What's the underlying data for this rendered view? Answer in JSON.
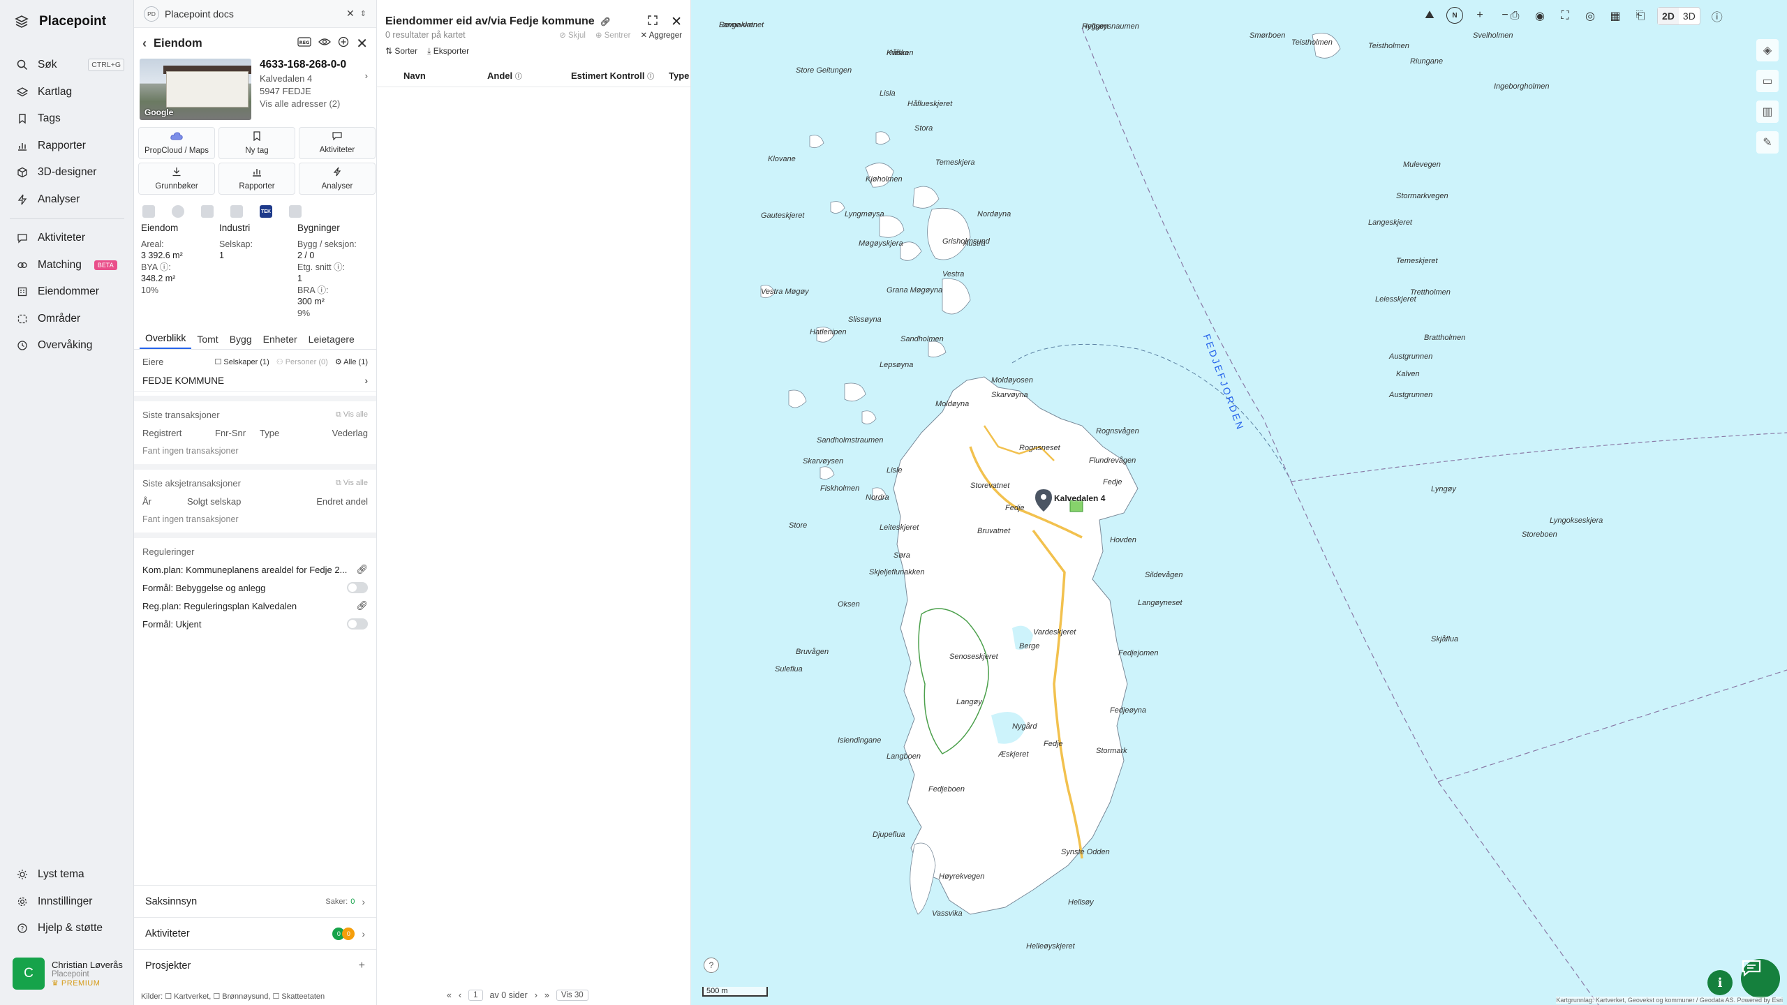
{
  "brand": {
    "name": "Placepoint"
  },
  "nav": {
    "items": [
      {
        "label": "Søk",
        "kbd": "CTRL+G",
        "icon": "search-icon"
      },
      {
        "label": "Kartlag",
        "icon": "layers-icon"
      },
      {
        "label": "Tags",
        "icon": "bookmark-icon"
      },
      {
        "label": "Rapporter",
        "icon": "bar-chart-icon"
      },
      {
        "label": "3D-designer",
        "icon": "cube-icon"
      },
      {
        "label": "Analyser",
        "icon": "bolt-icon"
      }
    ],
    "items2": [
      {
        "label": "Aktiviteter",
        "icon": "chat-icon"
      },
      {
        "label": "Matching",
        "badge": "BETA",
        "icon": "link-icon"
      },
      {
        "label": "Eiendommer",
        "icon": "building-icon"
      },
      {
        "label": "Områder",
        "icon": "area-icon"
      },
      {
        "label": "Overvåking",
        "icon": "clock-icon"
      }
    ],
    "bottom": [
      {
        "label": "Lyst tema",
        "icon": "sun-icon"
      },
      {
        "label": "Innstillinger",
        "icon": "gear-icon"
      },
      {
        "label": "Hjelp & støtte",
        "icon": "help-icon"
      }
    ]
  },
  "user": {
    "initial": "C",
    "name": "Christian Løverås",
    "org": "Placepoint",
    "plan": "PREMIUM"
  },
  "docs": {
    "avatar": "PD",
    "title": "Placepoint docs"
  },
  "property": {
    "header": "Eiendom",
    "gnr": "4633-168-268-0-0",
    "street": "Kalvedalen 4",
    "postal": "5947 FEDJE",
    "all_addresses": "Vis alle adresser (2)",
    "thumb_label": "Google",
    "buttons": [
      "PropCloud / Maps",
      "Ny tag",
      "Aktiviteter",
      "Grunnbøker",
      "Rapporter",
      "Analyser"
    ],
    "src_tek": "TEK",
    "stats": {
      "col1": {
        "head": "Eiendom",
        "l1": "Areal:",
        "v1": "3 392.6 m²",
        "l2": "BYA ⓘ:",
        "v2": "348.2 m²",
        "v3": "10%"
      },
      "col2": {
        "head": "Industri",
        "l1": "Selskap:",
        "v1": "1"
      },
      "col3": {
        "head": "Bygninger",
        "l1": "Bygg / seksjon:",
        "v1": "2 / 0",
        "l2": "Etg. snitt ⓘ:",
        "v2": "1",
        "l3": "BRA ⓘ:",
        "v3": "300 m²",
        "v4": "9%"
      }
    },
    "tabs": [
      "Overblikk",
      "Tomt",
      "Bygg",
      "Enheter",
      "Leietagere"
    ],
    "owners": {
      "label": "Eiere",
      "f1": "Selskaper (1)",
      "f2": "Personer (0)",
      "f3": "Alle (1)",
      "name": "FEDJE KOMMUNE"
    },
    "transactions": {
      "title": "Siste transaksjoner",
      "show_all": "Vis alle",
      "cols": [
        "Registrert",
        "Fnr-Snr",
        "Type",
        "Vederlag"
      ],
      "empty": "Fant ingen transaksjoner"
    },
    "share_tx": {
      "title": "Siste aksjetransaksjoner",
      "show_all": "Vis alle",
      "cols": [
        "År",
        "Solgt selskap",
        "Endret andel"
      ],
      "empty": "Fant ingen transaksjoner"
    },
    "regs": {
      "title": "Reguleringer",
      "r1": "Kom.plan: Kommuneplanens arealdel for Fedje 2...",
      "r2": "Formål: Bebyggelse og anlegg",
      "r3": "Reg.plan: Reguleringsplan Kalvedalen",
      "r4": "Formål: Ukjent"
    },
    "sections": {
      "s1": "Saksinnsyn",
      "s1_count_label": "Saker:",
      "s1_count": "0",
      "s2": "Aktiviteter",
      "s3": "Prosjekter",
      "s2_badge_a": "0",
      "s2_badge_b": "0"
    },
    "sources": "Kilder: ☐ Kartverket, ☐ Brønnøysund, ☐ Skatteetaten"
  },
  "results": {
    "title": "Eiendommer eid av/via Fedje kommune",
    "count": "0 resultater på kartet",
    "actions": [
      "Skjul",
      "Sentrer",
      "Aggreger"
    ],
    "tools": [
      "Sorter",
      "Eksporter"
    ],
    "columns": [
      "Navn",
      "Andel",
      "Estimert Kontroll",
      "Type"
    ],
    "pager": {
      "page": "1",
      "of": "av 0 sider",
      "per": "Vis 30"
    }
  },
  "map": {
    "view2d": "2D",
    "view3d": "3D",
    "scale": "500 m",
    "credit": "Kartgrunnlag: Kartverket, Geovekst og kommuner / Geodata AS. Powered by Esri",
    "fjord_label": "FEDJEFJORDEN",
    "marker_label": "Kalvedalen 4",
    "labels": [
      {
        "t": "Revnakken"
      },
      {
        "t": "Håflua"
      },
      {
        "t": "Ryggen"
      },
      {
        "t": "Smørboen"
      },
      {
        "t": "Teistholmen"
      },
      {
        "t": "Svelholmen"
      },
      {
        "t": "Teistholmen"
      },
      {
        "t": "Riungane"
      },
      {
        "t": "Ingeborgholmen"
      },
      {
        "t": "Store Geitungen"
      },
      {
        "t": "Lisla"
      },
      {
        "t": "Håflueskjeret"
      },
      {
        "t": "Stora"
      },
      {
        "t": "Klovane"
      },
      {
        "t": "Temeskjera"
      },
      {
        "t": "Kjøholmen"
      },
      {
        "t": "Gauteskjeret"
      },
      {
        "t": "Lyngmøysa"
      },
      {
        "t": "Nordøyna"
      },
      {
        "t": "Møgøyskjera"
      },
      {
        "t": "Austra"
      },
      {
        "t": "Grisholmsund"
      },
      {
        "t": "Grana Møgøyna"
      },
      {
        "t": "Vestra Møgøy"
      },
      {
        "t": "Vestra"
      },
      {
        "t": "Slissøyna"
      },
      {
        "t": "Lepsøyna"
      },
      {
        "t": "Sandholmen"
      },
      {
        "t": "Moldøyosen"
      },
      {
        "t": "Hatlenipen"
      },
      {
        "t": "Skarvøyna"
      },
      {
        "t": "Moldøyna"
      },
      {
        "t": "Sandholmstraumen"
      },
      {
        "t": "Skarvøysen"
      },
      {
        "t": "Lisle"
      },
      {
        "t": "Fiskholmen"
      },
      {
        "t": "Nordra"
      },
      {
        "t": "Store"
      },
      {
        "t": "Leiteskjeret"
      },
      {
        "t": "Skjeljeflunakken"
      },
      {
        "t": "Søra"
      },
      {
        "t": "Oksen"
      },
      {
        "t": "Bruvågen"
      },
      {
        "t": "Suleflua"
      },
      {
        "t": "Islendingane"
      },
      {
        "t": "Langboen"
      },
      {
        "t": "Fedjeboen"
      },
      {
        "t": "Djupeflua"
      },
      {
        "t": "Vassvika"
      },
      {
        "t": "Helleøyskjeret"
      },
      {
        "t": "Hellsøy"
      },
      {
        "t": "Synste Odden"
      },
      {
        "t": "Æskjeret"
      },
      {
        "t": "Stormark"
      },
      {
        "t": "Fedjeøyna"
      },
      {
        "t": "Fedjejomen"
      },
      {
        "t": "Langøyneset"
      },
      {
        "t": "Sildevågen"
      },
      {
        "t": "Hovden"
      },
      {
        "t": "Fedje"
      },
      {
        "t": "Flundrevågen"
      },
      {
        "t": "Rognsvågen"
      },
      {
        "t": "Rognsneset"
      },
      {
        "t": "Vardeskjeret"
      },
      {
        "t": "Berge"
      },
      {
        "t": "Nygård"
      },
      {
        "t": "Storevatnet"
      },
      {
        "t": "Bruvatnet"
      },
      {
        "t": "Fedje"
      },
      {
        "t": "Fedje"
      },
      {
        "t": "Mulevegen"
      },
      {
        "t": "Stormarkvegen"
      },
      {
        "t": "Langeskjeret"
      },
      {
        "t": "Temeskjeret"
      },
      {
        "t": "Trettholmen"
      },
      {
        "t": "Leiesskjeret"
      },
      {
        "t": "Brattholmen"
      },
      {
        "t": "Kalven"
      },
      {
        "t": "Lyngøy"
      },
      {
        "t": "Skjåflua"
      },
      {
        "t": "Storeboen"
      },
      {
        "t": "Lyngokseskjera"
      },
      {
        "t": "Senoseskjeret"
      },
      {
        "t": "Langøy"
      },
      {
        "t": "Høyrekvegen"
      },
      {
        "t": "Austgrunnen"
      },
      {
        "t": "Austgrunnen"
      },
      {
        "t": "Lange-vatnet"
      },
      {
        "t": "Kvisken"
      },
      {
        "t": "Hellsøysnaumen"
      }
    ]
  },
  "colors": {
    "accent": "#2563eb",
    "green": "#15803d",
    "sea": "#cdf3fb",
    "land": "#ffffff"
  }
}
